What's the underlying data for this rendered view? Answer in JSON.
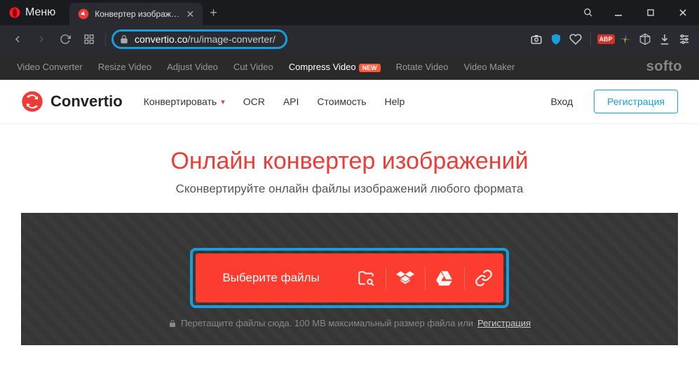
{
  "browser": {
    "menu_label": "Меню",
    "tab_title": "Конвертер изображений",
    "url_domain": "convertio.co",
    "url_path": "/ru/image-converter/"
  },
  "softo": {
    "items": [
      {
        "label": "Video Converter",
        "active": false,
        "new": false
      },
      {
        "label": "Resize Video",
        "active": false,
        "new": false
      },
      {
        "label": "Adjust Video",
        "active": false,
        "new": false
      },
      {
        "label": "Cut Video",
        "active": false,
        "new": false
      },
      {
        "label": "Compress Video",
        "active": true,
        "new": true
      },
      {
        "label": "Rotate Video",
        "active": false,
        "new": false
      },
      {
        "label": "Video Maker",
        "active": false,
        "new": false
      }
    ],
    "new_badge": "NEW",
    "logo": "softo"
  },
  "site": {
    "brand": "Convertio",
    "nav": {
      "convert": "Конвертировать",
      "ocr": "OCR",
      "api": "API",
      "pricing": "Стоимость",
      "help": "Help"
    },
    "login": "Вход",
    "signup": "Регистрация"
  },
  "hero": {
    "title": "Онлайн конвертер изображений",
    "subtitle": "Сконвертируйте онлайн файлы изображений любого формата"
  },
  "dropzone": {
    "choose_files": "Выберите файлы",
    "hint_prefix": "Перетащите файлы сюда. 100 MB максимальный размер файла или",
    "hint_link": "Регистрация"
  },
  "abp": "ABP"
}
